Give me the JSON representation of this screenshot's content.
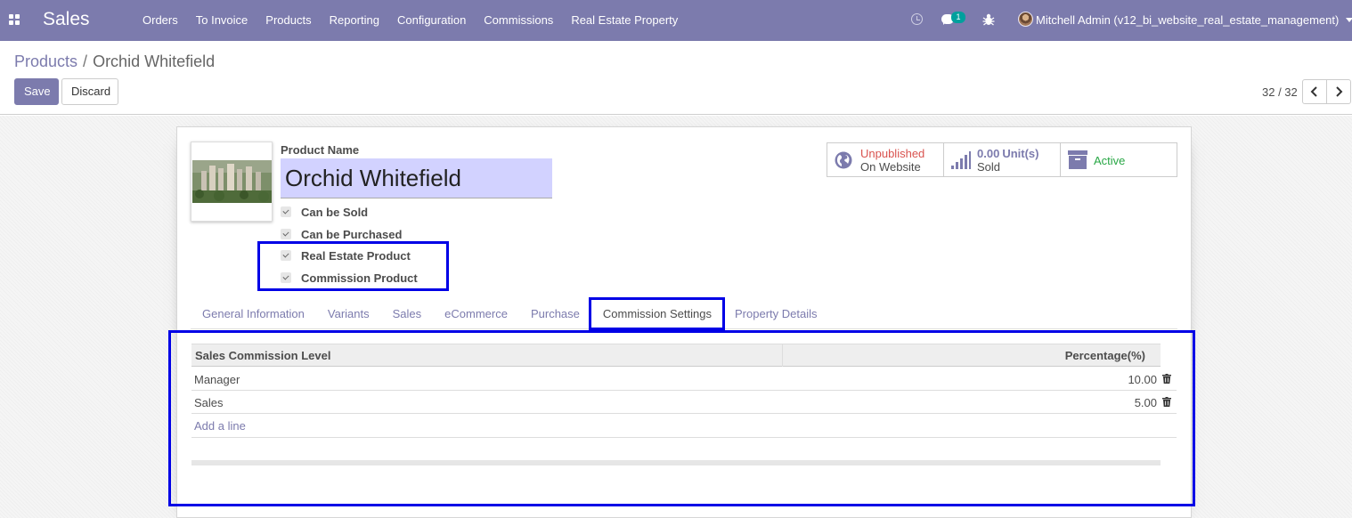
{
  "navbar": {
    "brand": "Sales",
    "menu": [
      "Orders",
      "To Invoice",
      "Products",
      "Reporting",
      "Configuration",
      "Commissions",
      "Real Estate Property"
    ],
    "chat_count": "1",
    "user": "Mitchell Admin (v12_bi_website_real_estate_management)",
    "icons": [
      "apps-icon",
      "clock-icon",
      "chat-icon",
      "bug-icon",
      "avatar",
      "caret-down-icon"
    ]
  },
  "control_panel": {
    "breadcrumb_parent": "Products",
    "breadcrumb_sep": "/",
    "breadcrumb_current": "Orchid Whitefield",
    "save_label": "Save",
    "discard_label": "Discard",
    "pager": "32 / 32"
  },
  "form": {
    "product_name_label": "Product Name",
    "product_name": "Orchid Whitefield",
    "checkboxes": [
      {
        "label": "Can be Sold",
        "checked": true
      },
      {
        "label": "Can be Purchased",
        "checked": true
      },
      {
        "label": "Real Estate Product",
        "checked": true
      },
      {
        "label": "Commission Product",
        "checked": true
      }
    ],
    "smart_buttons": {
      "website_status": "Unpublished",
      "website_label": "On Website",
      "sold_value": "0.00",
      "sold_unit": "Unit(s)",
      "sold_label": "Sold",
      "active_label": "Active"
    },
    "tabs": [
      "General Information",
      "Variants",
      "Sales",
      "eCommerce",
      "Purchase",
      "Commission Settings",
      "Property Details"
    ],
    "active_tab": "Commission Settings",
    "table": {
      "columns": [
        "Sales Commission Level",
        "Percentage(%)"
      ],
      "rows": [
        {
          "level": "Manager",
          "percentage": "10.00"
        },
        {
          "level": "Sales",
          "percentage": "5.00"
        }
      ],
      "add_line": "Add a line"
    }
  },
  "colors": {
    "navbar": "#7c7bad",
    "highlight": "#0000e6",
    "name_field_bg": "#d2d2ff",
    "unpublished": "#d9534f",
    "active": "#28a745"
  }
}
